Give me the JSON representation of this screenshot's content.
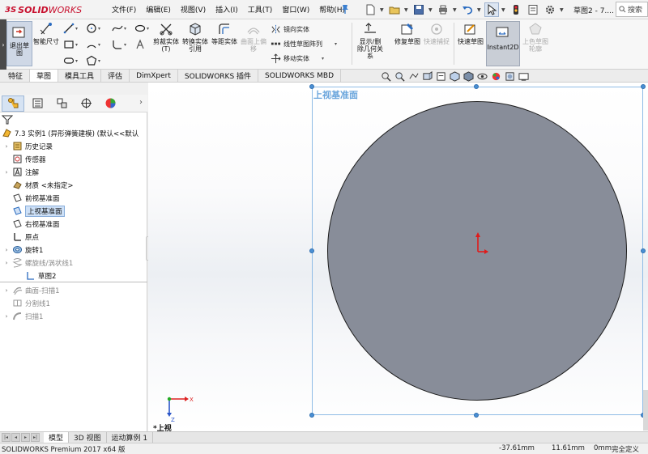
{
  "app": {
    "logo_prefix": "3S",
    "logo_solid": "SOLID",
    "logo_works": "WORKS",
    "doc_title": "草图2 - 7...."
  },
  "menu": [
    "文件(F)",
    "编辑(E)",
    "视图(V)",
    "插入(I)",
    "工具(T)",
    "窗口(W)",
    "帮助(H)"
  ],
  "search": {
    "placeholder": "搜索"
  },
  "commands": {
    "side_tab": "›",
    "exit_sketch": "退出草图",
    "smart_dim": "智能尺寸",
    "trim": "剪裁实体(T)",
    "convert": "转换实体引用",
    "offset": "等距实体",
    "surface_offset": "曲面上偏移",
    "mirror": "镜向实体",
    "linear_pattern": "线性草图阵列",
    "move": "移动实体",
    "display_delete": "显示/删除几何关系",
    "repair": "修复草图",
    "quick_snap": "快速捕捉",
    "rapid_sketch": "快速草图",
    "instant2d": "Instant2D",
    "shade": "上色草图轮廓"
  },
  "tabs": [
    "特征",
    "草图",
    "模具工具",
    "评估",
    "DimXpert",
    "SOLIDWORKS 插件",
    "SOLIDWORKS MBD"
  ],
  "active_tab": "草图",
  "tree": {
    "root": "7.3 实例1 (异形弹簧建模)  (默认<<默认",
    "items": [
      {
        "label": "历史记录",
        "icon": "history-icon",
        "expand": true,
        "dim": false
      },
      {
        "label": "传感器",
        "icon": "sensor-icon",
        "expand": false,
        "dim": false
      },
      {
        "label": "注解",
        "icon": "annotation-icon",
        "expand": true,
        "dim": false
      },
      {
        "label": "材质 <未指定>",
        "icon": "material-icon",
        "expand": false,
        "dim": false
      },
      {
        "label": "前视基准面",
        "icon": "plane-icon",
        "expand": false,
        "dim": false
      },
      {
        "label": "上视基准面",
        "icon": "plane-icon",
        "expand": false,
        "dim": false,
        "selected": true
      },
      {
        "label": "右视基准面",
        "icon": "plane-icon",
        "expand": false,
        "dim": false
      },
      {
        "label": "原点",
        "icon": "origin-icon",
        "expand": false,
        "dim": false
      },
      {
        "label": "旋转1",
        "icon": "revolve-icon",
        "expand": true,
        "dim": false
      },
      {
        "label": "螺旋线/涡状线1",
        "icon": "helix-icon",
        "expand": true,
        "dim": true
      },
      {
        "label": "草图2",
        "icon": "sketch-icon",
        "expand": false,
        "dim": false
      },
      {
        "label": "曲面-扫描1",
        "icon": "surface-sweep-icon",
        "expand": true,
        "dim": true
      },
      {
        "label": "分割线1",
        "icon": "split-line-icon",
        "expand": false,
        "dim": true
      },
      {
        "label": "扫描1",
        "icon": "sweep-icon",
        "expand": true,
        "dim": true
      }
    ]
  },
  "graphics": {
    "plane_label": "上视基准面",
    "view_name": "*上视",
    "triad_x": "X",
    "triad_z": "Z"
  },
  "bottom_tabs": [
    "模型",
    "3D 视图",
    "运动算例 1"
  ],
  "active_bottom_tab": "模型",
  "status": {
    "product": "SOLIDWORKS Premium 2017 x64 版",
    "x": "-37.61mm",
    "y": "11.61mm",
    "z": "0mm",
    "state": "完全定义"
  },
  "colors": {
    "accent_red": "#c8102e",
    "plane_blue": "#6aa5dc",
    "circle_fill": "#888d99",
    "origin_red": "#e01b1b"
  }
}
